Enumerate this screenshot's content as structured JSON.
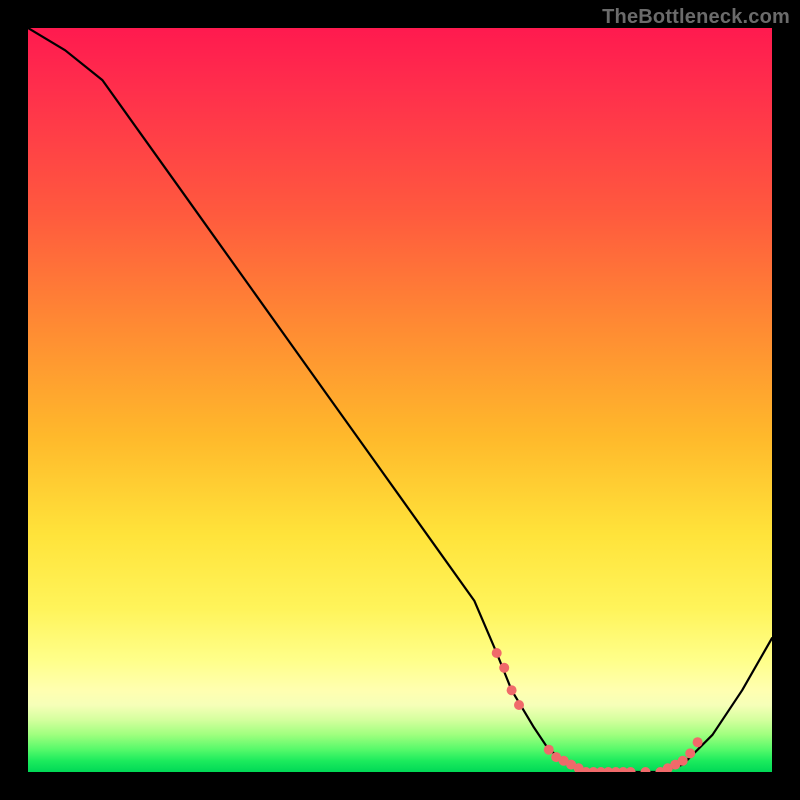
{
  "watermark": "TheBottleneck.com",
  "colors": {
    "frame": "#000000",
    "curve": "#000000",
    "dot": "#f06a6a",
    "gradient_top": "#ff1a4f",
    "gradient_bottom": "#00d856"
  },
  "chart_data": {
    "type": "line",
    "title": "",
    "xlabel": "",
    "ylabel": "",
    "xlim": [
      0,
      100
    ],
    "ylim": [
      0,
      100
    ],
    "grid": false,
    "legend": false,
    "series": [
      {
        "name": "bottleneck-curve",
        "x": [
          0,
          5,
          10,
          15,
          20,
          25,
          30,
          35,
          40,
          45,
          50,
          55,
          60,
          63,
          65,
          68,
          70,
          73,
          75,
          78,
          80,
          83,
          85,
          88,
          92,
          96,
          100
        ],
        "y": [
          100,
          97,
          93,
          86,
          79,
          72,
          65,
          58,
          51,
          44,
          37,
          30,
          23,
          16,
          11,
          6,
          3,
          1,
          0,
          0,
          0,
          0,
          0,
          1,
          5,
          11,
          18
        ]
      }
    ],
    "dots": {
      "name": "highlight-dots",
      "x": [
        63,
        64,
        65,
        66,
        70,
        71,
        72,
        73,
        74,
        75,
        76,
        77,
        78,
        79,
        80,
        81,
        83,
        85,
        86,
        87,
        88,
        89,
        90
      ],
      "y": [
        16,
        14,
        11,
        9,
        3,
        2,
        1.5,
        1,
        0.5,
        0,
        0,
        0,
        0,
        0,
        0,
        0,
        0,
        0,
        0.5,
        1,
        1.5,
        2.5,
        4
      ]
    }
  }
}
